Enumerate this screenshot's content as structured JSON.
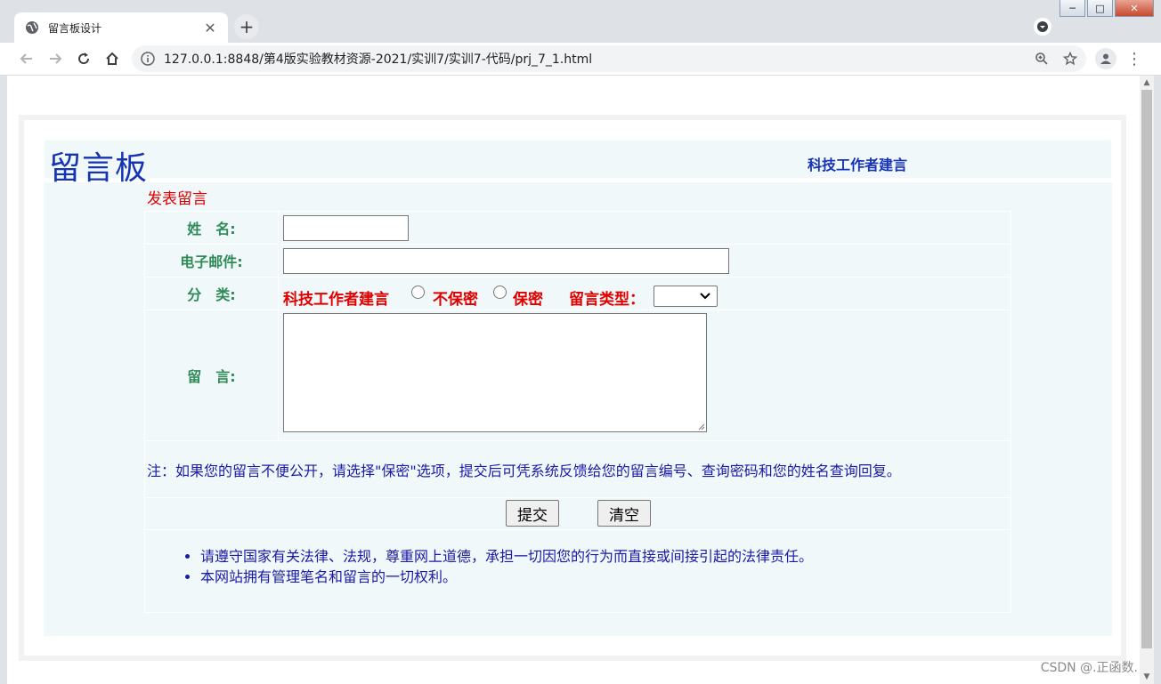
{
  "browser": {
    "tab_title": "留言板设计",
    "tab_close": "✕",
    "new_tab": "+",
    "url": "127.0.0.1:8848/第4版实验教材资源-2021/实训7/实训7-代码/prj_7_1.html",
    "window_min": "─",
    "window_max": "□",
    "window_close": "✕",
    "kebab": "⋮"
  },
  "page": {
    "title": "留言板",
    "subtitle": "科技工作者建言",
    "post_heading": "发表留言"
  },
  "form": {
    "name_label": "姓　名:",
    "name_value": "",
    "email_label": "电子邮件:",
    "email_value": "",
    "category_label": "分　类:",
    "category_text": "科技工作者建言",
    "option_public": "不保密",
    "option_private": "保密",
    "message_type_label": "留言类型：",
    "message_type_selected": "",
    "message_label": "留　言:",
    "message_value": "",
    "note": "注：如果您的留言不便公开，请选择\"保密\"选项，提交后可凭系统反馈给您的留言编号、查询密码和您的姓名查询回复。",
    "submit_label": "提交",
    "reset_label": "清空"
  },
  "notices": [
    "请遵守国家有关法律、法规，尊重网上道德，承担一切因您的行为而直接或间接引起的法律责任。",
    "本网站拥有管理笔名和留言的一切权利。"
  ],
  "watermark": "CSDN @.正函数.",
  "colors": {
    "title_blue": "#1633b3",
    "label_green": "#2e8b57",
    "option_red": "#e00000",
    "note_blue": "#1a1aa6",
    "panel_bg": "#f0f8fa"
  }
}
